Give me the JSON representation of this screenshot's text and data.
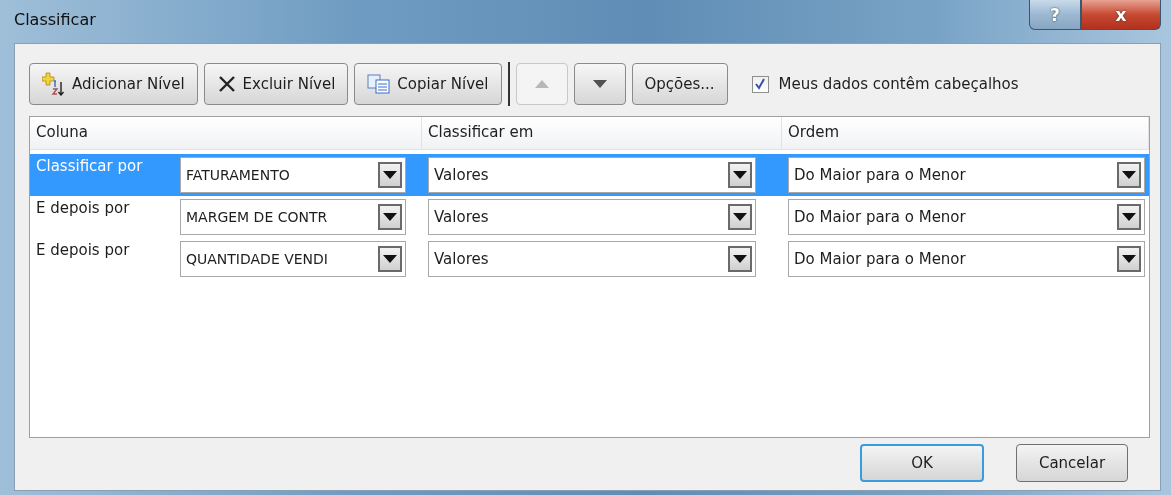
{
  "window": {
    "title": "Classificar",
    "help_glyph": "?",
    "close_glyph": "x"
  },
  "toolbar": [
    {
      "kind": "add",
      "label": "Adicionar Nível",
      "disabled": false
    },
    {
      "kind": "delete",
      "label": "Excluir Nível",
      "disabled": false
    },
    {
      "kind": "copy",
      "label": "Copiar Nível",
      "disabled": false
    },
    {
      "kind": "separator"
    },
    {
      "kind": "up",
      "disabled": true
    },
    {
      "kind": "down",
      "disabled": false
    },
    {
      "kind": "text",
      "label": "Opções...",
      "disabled": false
    }
  ],
  "header_checkbox": {
    "label": "Meus dados contêm cabeçalhos",
    "checked": true
  },
  "table": {
    "columns": [
      "Coluna",
      "Classificar em",
      "Ordem"
    ],
    "rows": [
      {
        "label": "Classificar por",
        "column": "FATURAMENTO",
        "sort_on": "Valores",
        "order": "Do Maior para o Menor",
        "selected": true
      },
      {
        "label": "E depois por",
        "column": "MARGEM DE CONTR",
        "sort_on": "Valores",
        "order": "Do Maior para o Menor",
        "selected": false
      },
      {
        "label": "E depois por",
        "column": "QUANTIDADE VENDI",
        "sort_on": "Valores",
        "order": "Do Maior para o Menor",
        "selected": false
      }
    ]
  },
  "buttons": [
    {
      "label": "OK",
      "default": true
    },
    {
      "label": "Cancelar",
      "default": false
    }
  ]
}
